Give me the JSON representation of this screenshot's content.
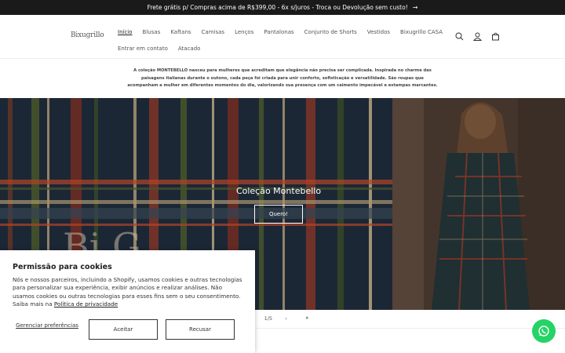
{
  "announcement": {
    "text": "Frete grátis p/ Compras acima de R$399,00 - 6x s/juros - Troca ou Devolução sem custo!",
    "arrow": "→"
  },
  "header": {
    "logo": "Bixugrillo",
    "nav_row1": [
      "Início",
      "Blusas",
      "Kaftans",
      "Camisas",
      "Lenços",
      "Pantalonas",
      "Conjunto de Shorts",
      "Vestidos",
      "Bixugrillo CASA"
    ],
    "nav_row2": [
      "Entrar em contato",
      "Atacado"
    ],
    "icons": [
      "search-icon",
      "account-icon",
      "cart-icon"
    ]
  },
  "intro": "A coleção MONTEBELLO nasceu para mulheres que acreditam que elegância não precisa ser complicada. Inspirada no charme das paisagens italianas durante o outono, cada peça foi criada para unir conforto, sofisticação e versatilidade. São roupas que acompanham a mulher em diferentes momentos do dia, valorizando sua presença com um caimento impecável e estampas marcantes.",
  "hero": {
    "title": "Coleção Montebello",
    "button": "Quero!",
    "bg_letters": "Bi   G"
  },
  "slider": {
    "counter": "1/5",
    "prev": "‹",
    "next": "›",
    "pause": "⏸"
  },
  "cookie": {
    "title": "Permissão para cookies",
    "body": "Nós e nossos parceiros, incluindo a Shopify, usamos cookies e outras tecnologias para personalizar sua experiência, exibir anúncios e realizar análises. Não usamos cookies ou outras tecnologias para esses fins sem o seu consentimento. Saiba mais na",
    "link": "Política de privacidade",
    "manage": "Gerenciar preferências",
    "accept": "Aceitar",
    "decline": "Recusar"
  },
  "colors": {
    "announce_bg": "#1a1a1a",
    "whatsapp": "#25d366",
    "plaid_bg": "#1e2a3a"
  }
}
